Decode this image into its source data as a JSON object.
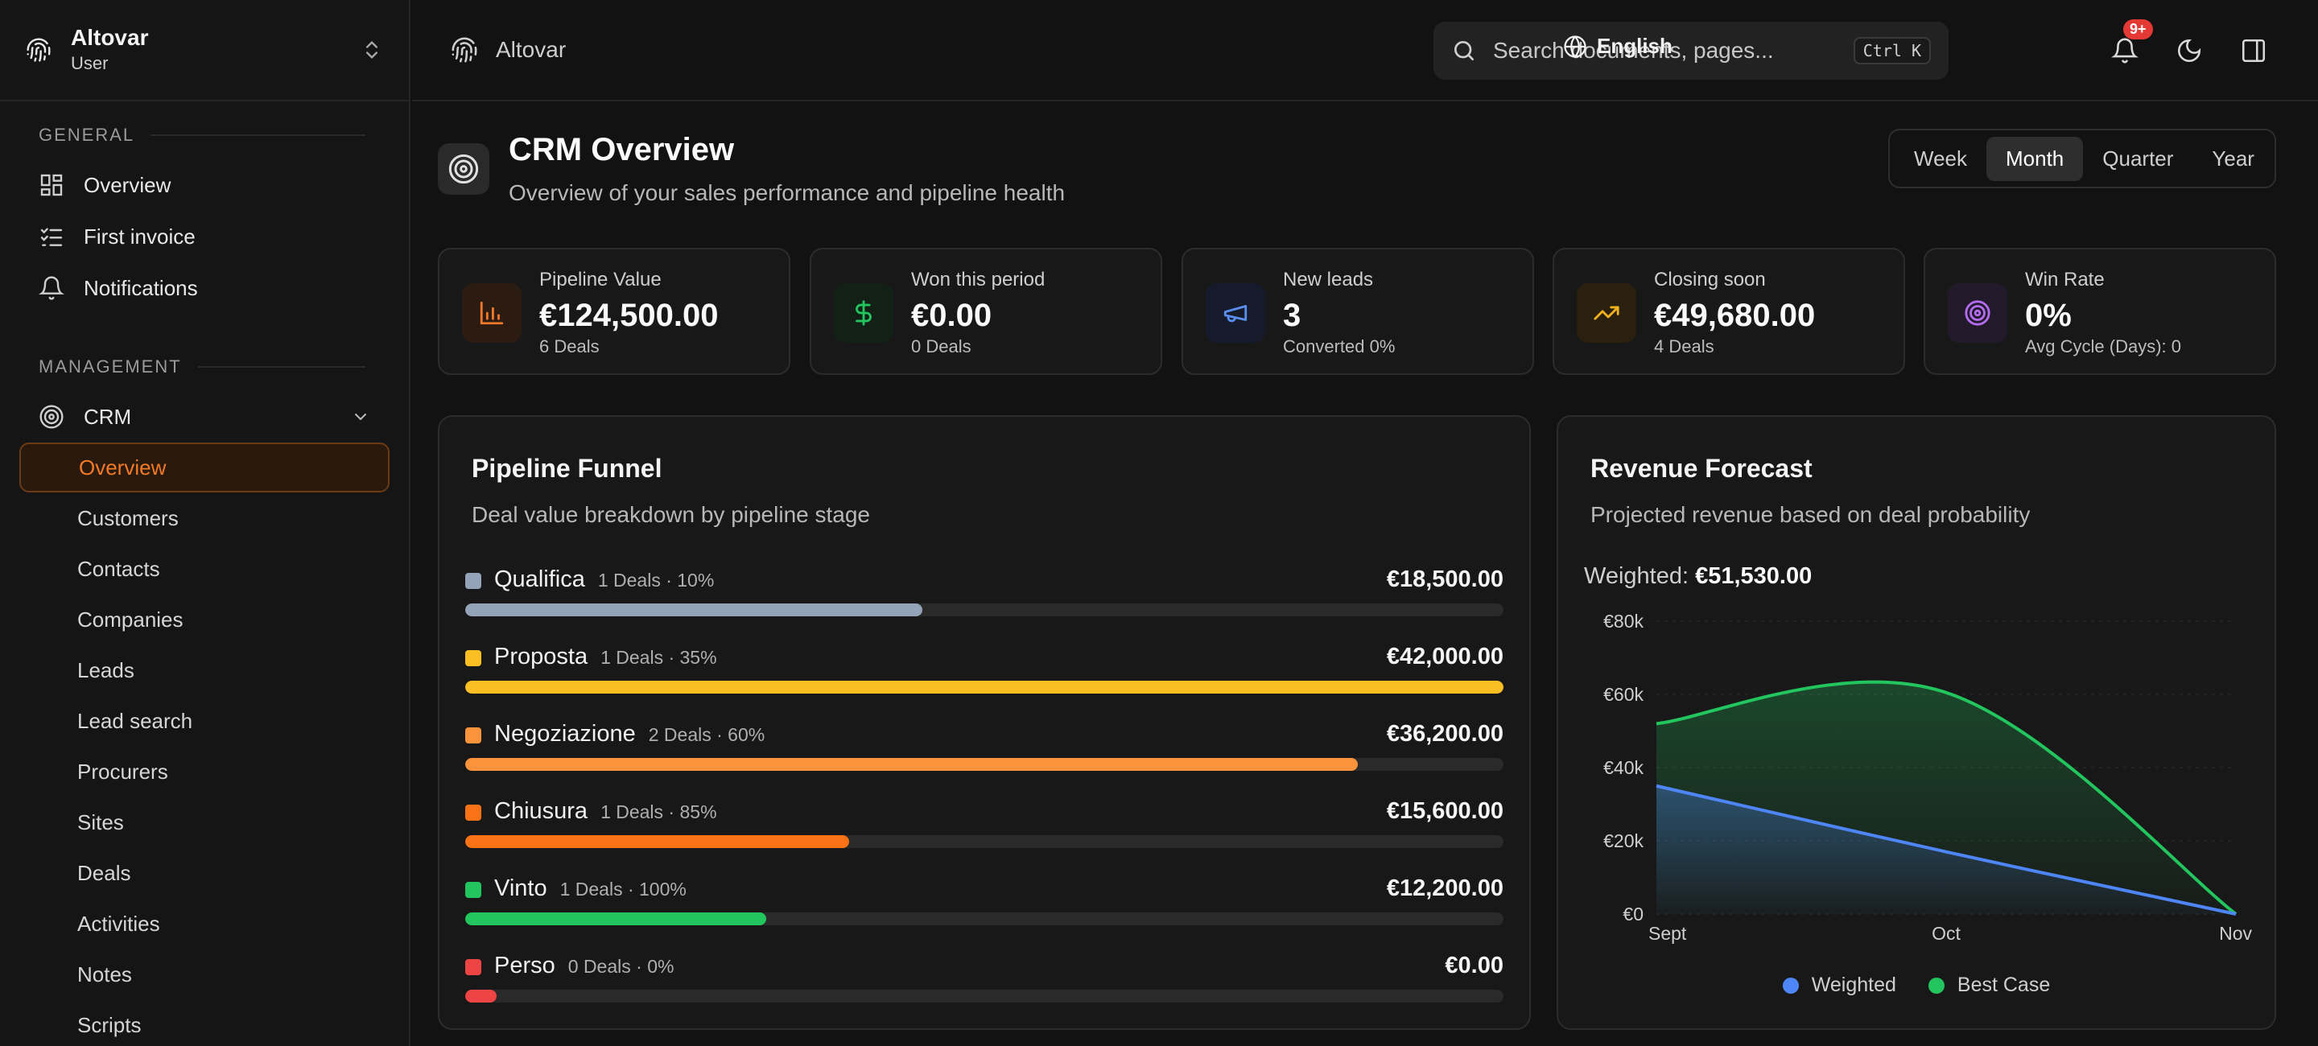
{
  "sidebar": {
    "brand_name": "Altovar",
    "brand_role": "User",
    "general_label": "GENERAL",
    "general_items": [
      {
        "label": "Overview",
        "icon": "grid-icon"
      },
      {
        "label": "First invoice",
        "icon": "checklist-icon"
      },
      {
        "label": "Notifications",
        "icon": "bell-icon"
      }
    ],
    "management_label": "MANAGEMENT",
    "crm_label": "CRM",
    "crm_items": [
      "Overview",
      "Customers",
      "Contacts",
      "Companies",
      "Leads",
      "Lead search",
      "Procurers",
      "Sites",
      "Deals",
      "Activities",
      "Notes",
      "Scripts"
    ],
    "active_crm_item": "Overview"
  },
  "topbar": {
    "breadcrumb": "Altovar",
    "search_placeholder": "Search documents, pages...",
    "search_shortcut": "Ctrl K",
    "language": "English",
    "notification_badge": "9+"
  },
  "header": {
    "title": "CRM Overview",
    "subtitle": "Overview of your sales performance and pipeline health",
    "periods": [
      "Week",
      "Month",
      "Quarter",
      "Year"
    ],
    "active_period": "Month"
  },
  "stats": [
    {
      "label": "Pipeline Value",
      "value": "€124,500.00",
      "sub": "6 Deals",
      "icon": "bar-chart-icon",
      "color": "#f07a2a",
      "bg": "#2b1b10"
    },
    {
      "label": "Won this period",
      "value": "€0.00",
      "sub": "0 Deals",
      "icon": "dollar-icon",
      "color": "#22c55e",
      "bg": "#132016"
    },
    {
      "label": "New leads",
      "value": "3",
      "sub": "Converted 0%",
      "icon": "megaphone-icon",
      "color": "#5b8def",
      "bg": "#151b2a"
    },
    {
      "label": "Closing soon",
      "value": "€49,680.00",
      "sub": "4 Deals",
      "icon": "trending-up-icon",
      "color": "#f5b21d",
      "bg": "#2a2010"
    },
    {
      "label": "Win Rate",
      "value": "0%",
      "sub": "Avg Cycle (Days): 0",
      "icon": "target-icon",
      "color": "#b36cf0",
      "bg": "#221a2b"
    }
  ],
  "funnel": {
    "title": "Pipeline Funnel",
    "subtitle": "Deal value breakdown by pipeline stage",
    "stages": [
      {
        "name": "Qualifica",
        "meta": "1 Deals · 10%",
        "amount": "€18,500.00",
        "color": "#94a3b8",
        "fill": 0.44
      },
      {
        "name": "Proposta",
        "meta": "1 Deals · 35%",
        "amount": "€42,000.00",
        "color": "#fbbf24",
        "fill": 1.0
      },
      {
        "name": "Negoziazione",
        "meta": "2 Deals · 60%",
        "amount": "€36,200.00",
        "color": "#fb923c",
        "fill": 0.86
      },
      {
        "name": "Chiusura",
        "meta": "1 Deals · 85%",
        "amount": "€15,600.00",
        "color": "#f97316",
        "fill": 0.37
      },
      {
        "name": "Vinto",
        "meta": "1 Deals · 100%",
        "amount": "€12,200.00",
        "color": "#22c55e",
        "fill": 0.29
      },
      {
        "name": "Perso",
        "meta": "0 Deals · 0%",
        "amount": "€0.00",
        "color": "#ef4444",
        "fill": 0.03
      }
    ]
  },
  "forecast": {
    "title": "Revenue Forecast",
    "subtitle": "Projected revenue based on deal probability",
    "weighted_label": "Weighted:",
    "weighted_value": "€51,530.00"
  },
  "chart_data": {
    "type": "area",
    "categories": [
      "Sept",
      "Oct",
      "Nov"
    ],
    "series": [
      {
        "name": "Weighted",
        "color": "#4f86f7",
        "values": [
          35000,
          17000,
          0
        ]
      },
      {
        "name": "Best Case",
        "color": "#22c55e",
        "values": [
          52000,
          60500,
          0
        ]
      }
    ],
    "y_ticks": [
      "€0",
      "€20k",
      "€40k",
      "€60k",
      "€80k"
    ],
    "ylim": [
      0,
      80000
    ],
    "grid": true,
    "legend": "bottom"
  }
}
